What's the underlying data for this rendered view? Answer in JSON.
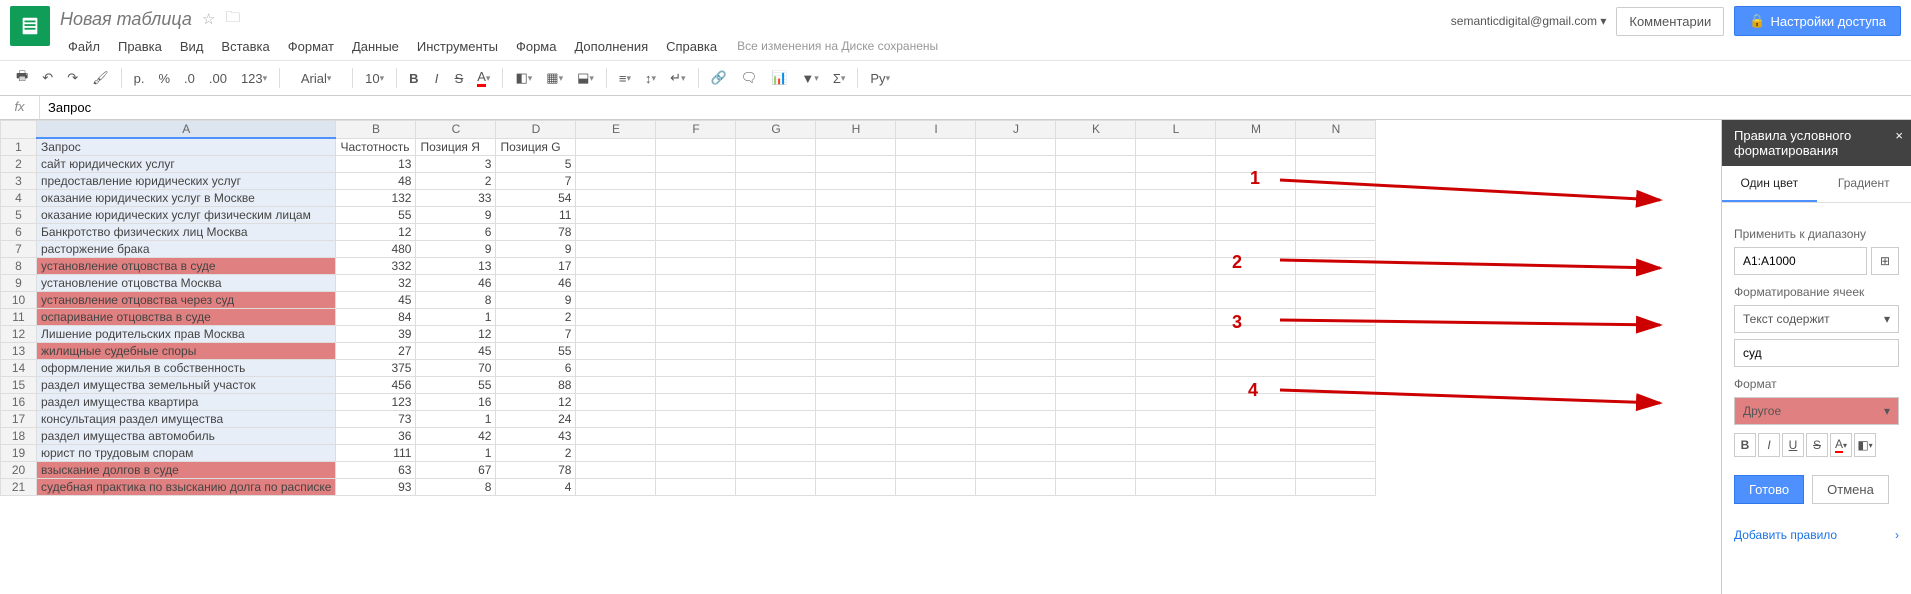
{
  "header": {
    "title": "Новая таблица",
    "user_email": "semanticdigital@gmail.com",
    "comments_btn": "Комментарии",
    "share_btn": "Настройки доступа",
    "save_status": "Все изменения на Диске сохранены"
  },
  "menus": [
    "Файл",
    "Правка",
    "Вид",
    "Вставка",
    "Формат",
    "Данные",
    "Инструменты",
    "Форма",
    "Дополнения",
    "Справка"
  ],
  "toolbar": {
    "currency": "р.",
    "percent": "%",
    "dec_dec": ".0",
    "dec_inc": ".00",
    "numfmt": "123",
    "font": "Arial",
    "size": "10",
    "more": "Ру"
  },
  "formula": {
    "fx": "fx",
    "value": "Запрос"
  },
  "columns": [
    "A",
    "B",
    "C",
    "D",
    "E",
    "F",
    "G",
    "H",
    "I",
    "J",
    "K",
    "L",
    "M",
    "N"
  ],
  "col_widths": {
    "A": 264,
    "B": 80,
    "C": 80,
    "D": 80
  },
  "rows": [
    {
      "n": 1,
      "a": "Запрос",
      "b": "Частотность",
      "c": "Позиция Я",
      "d": "Позиция G",
      "hdr": true
    },
    {
      "n": 2,
      "a": "сайт юридических услуг",
      "b": 13,
      "c": 3,
      "d": 5
    },
    {
      "n": 3,
      "a": "предоставление юридических услуг",
      "b": 48,
      "c": 2,
      "d": 7
    },
    {
      "n": 4,
      "a": "оказание юридических услуг в Москве",
      "b": 132,
      "c": 33,
      "d": 54
    },
    {
      "n": 5,
      "a": "оказание юридических услуг физическим лицам",
      "b": 55,
      "c": 9,
      "d": 11
    },
    {
      "n": 6,
      "a": "Банкротство физических лиц Москва",
      "b": 12,
      "c": 6,
      "d": 78
    },
    {
      "n": 7,
      "a": "расторжение брака",
      "b": 480,
      "c": 9,
      "d": 9
    },
    {
      "n": 8,
      "a": "установление отцовства в суде",
      "b": 332,
      "c": 13,
      "d": 17,
      "red": true
    },
    {
      "n": 9,
      "a": "установление отцовства Москва",
      "b": 32,
      "c": 46,
      "d": 46
    },
    {
      "n": 10,
      "a": "установление отцовства через суд",
      "b": 45,
      "c": 8,
      "d": 9,
      "red": true
    },
    {
      "n": 11,
      "a": "оспаривание отцовства в суде",
      "b": 84,
      "c": 1,
      "d": 2,
      "red": true
    },
    {
      "n": 12,
      "a": "Лишение родительских прав Москва",
      "b": 39,
      "c": 12,
      "d": 7
    },
    {
      "n": 13,
      "a": "жилищные судебные споры",
      "b": 27,
      "c": 45,
      "d": 55,
      "red": true
    },
    {
      "n": 14,
      "a": "оформление жилья в собственность",
      "b": 375,
      "c": 70,
      "d": 6
    },
    {
      "n": 15,
      "a": "раздел имущества земельный участок",
      "b": 456,
      "c": 55,
      "d": 88
    },
    {
      "n": 16,
      "a": "раздел имущества квартира",
      "b": 123,
      "c": 16,
      "d": 12
    },
    {
      "n": 17,
      "a": "консультация раздел имущества",
      "b": 73,
      "c": 1,
      "d": 24
    },
    {
      "n": 18,
      "a": "раздел имущества автомобиль",
      "b": 36,
      "c": 42,
      "d": 43
    },
    {
      "n": 19,
      "a": "юрист по трудовым спорам",
      "b": 111,
      "c": 1,
      "d": 2
    },
    {
      "n": 20,
      "a": "взыскание долгов в суде",
      "b": 63,
      "c": 67,
      "d": 78,
      "red": true
    },
    {
      "n": 21,
      "a": "судебная практика по взысканию долга по расписке",
      "b": 93,
      "c": 8,
      "d": 4,
      "red": true
    }
  ],
  "rp": {
    "title": "Правила условного форматирования",
    "tab1": "Один цвет",
    "tab2": "Градиент",
    "apply_range_label": "Применить к диапазону",
    "range": "A1:A1000",
    "format_cells_label": "Форматирование ячеек",
    "condition": "Текст содержит",
    "value": "суд",
    "format_label": "Формат",
    "preview": "Другое",
    "done": "Готово",
    "cancel": "Отмена",
    "add_rule": "Добавить правило"
  },
  "annotations": {
    "a1": "1",
    "a2": "2",
    "a3": "3",
    "a4": "4"
  }
}
